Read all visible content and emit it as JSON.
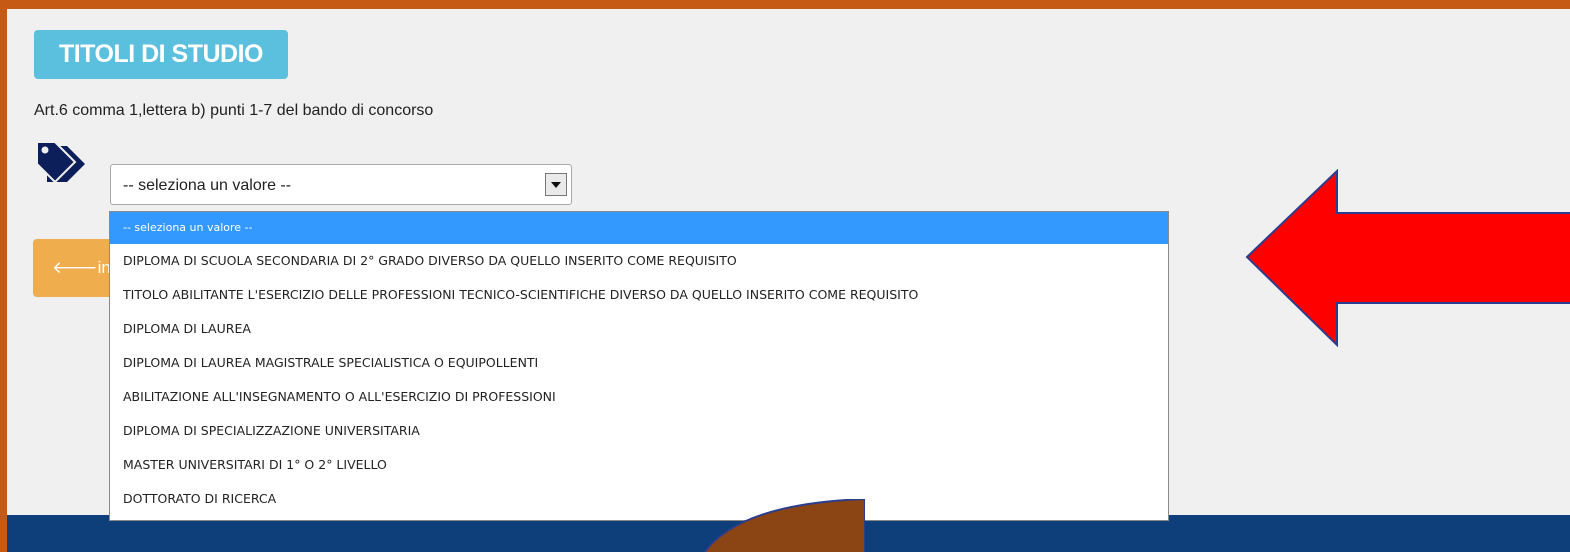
{
  "section": {
    "badge_label": "TITOLI DI STUDIO",
    "subtitle": "Art.6 comma 1,lettera b) punti 1-7 del bando di concorso",
    "tag_icon": "tags-icon"
  },
  "select": {
    "current_value": "-- seleziona un valore --",
    "options": [
      "-- seleziona un valore --",
      "DIPLOMA DI SCUOLA SECONDARIA DI 2° GRADO DIVERSO DA QUELLO INSERITO COME REQUISITO",
      "TITOLO ABILITANTE L'ESERCIZIO DELLE PROFESSIONI TECNICO-SCIENTIFICHE DIVERSO DA QUELLO INSERITO COME REQUISITO",
      "DIPLOMA DI LAUREA",
      "DIPLOMA DI LAUREA MAGISTRALE SPECIALISTICA O EQUIPOLLENTI",
      "ABILITAZIONE ALL'INSEGNAMENTO O ALL'ESERCIZIO DI PROFESSIONI",
      "DIPLOMA DI SPECIALIZZAZIONE UNIVERSITARIA",
      "MASTER UNIVERSITARI DI 1° O 2° LIVELLO",
      "DOTTORATO DI RICERCA"
    ],
    "highlighted_index": 0
  },
  "buttons": {
    "back_label": "ind",
    "back_icon": "arrow-left-icon"
  },
  "colors": {
    "accent_badge": "#5bc0de",
    "back_button": "#f0ad4e",
    "highlight": "#3399ff",
    "annotation_arrow": "#ff0000",
    "border_frame": "#c65a14",
    "footer": "#0e3f7a"
  }
}
